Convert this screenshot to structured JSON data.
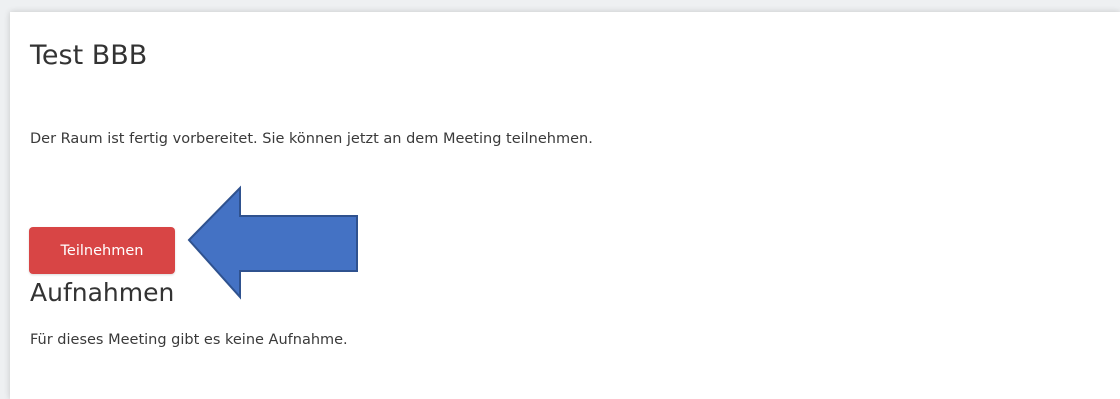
{
  "meeting": {
    "title": "Test BBB",
    "status_text": "Der Raum ist fertig vorbereitet. Sie können jetzt an dem Meeting teilnehmen.",
    "join_label": "Teilnehmen"
  },
  "recordings": {
    "heading": "Aufnahmen",
    "empty_text": "Für dieses Meeting gibt es keine Aufnahme."
  },
  "colors": {
    "join_button": "#d84545",
    "annotation_arrow_fill": "#4472c4",
    "annotation_arrow_stroke": "#2f528f"
  },
  "annotation": {
    "icon": "left-arrow-icon"
  }
}
